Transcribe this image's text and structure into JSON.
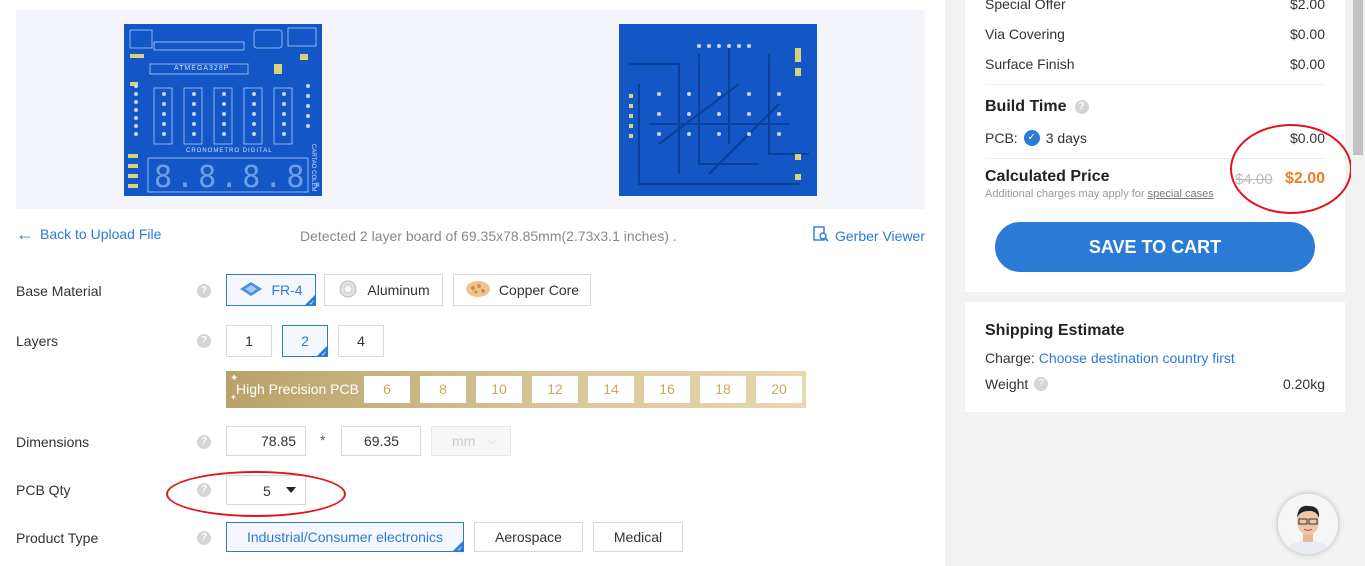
{
  "preview": {
    "top_chip_label": "ATMEGA328P",
    "board_caption": "CRONOMETRO DIGITAL",
    "digits_display": "8.8.8.8.",
    "side_caption": "CARTAO COLEM"
  },
  "nav": {
    "back_label": "Back to Upload File",
    "detected_text": "Detected 2 layer board of 69.35x78.85mm(2.73x3.1 inches) .",
    "gerber_label": "Gerber Viewer"
  },
  "form": {
    "help_glyph": "?",
    "base_material": {
      "label": "Base Material",
      "options": [
        "FR-4",
        "Aluminum",
        "Copper Core"
      ],
      "selected": "FR-4"
    },
    "layers": {
      "label": "Layers",
      "options": [
        "1",
        "2",
        "4"
      ],
      "selected": "2"
    },
    "high_precision": {
      "label": "High Precision PCB",
      "options": [
        "6",
        "8",
        "10",
        "12",
        "14",
        "16",
        "18",
        "20"
      ]
    },
    "dimensions": {
      "label": "Dimensions",
      "width": "78.85",
      "separator": "*",
      "height": "69.35",
      "unit": "mm"
    },
    "pcb_qty": {
      "label": "PCB Qty",
      "value": "5"
    },
    "product_type": {
      "label": "Product Type",
      "options": [
        "Industrial/Consumer electronics",
        "Aerospace",
        "Medical"
      ],
      "selected": "Industrial/Consumer electronics"
    }
  },
  "price": {
    "rows": [
      {
        "label": "Special Offer",
        "value": "$2.00"
      },
      {
        "label": "Via Covering",
        "value": "$0.00"
      },
      {
        "label": "Surface Finish",
        "value": "$0.00"
      }
    ],
    "build_time_title": "Build Time",
    "pcb_label": "PCB:",
    "pcb_days": "3 days",
    "pcb_value": "$0.00",
    "calc_title": "Calculated Price",
    "old_price": "$4.00",
    "new_price": "$2.00",
    "note_prefix": "Additional charges may apply for",
    "note_link": "special cases",
    "cart_button": "SAVE TO CART"
  },
  "shipping": {
    "title": "Shipping Estimate",
    "charge_label": "Charge:",
    "charge_link": "Choose destination country first",
    "weight_label": "Weight",
    "weight_value": "0.20kg"
  },
  "colors": {
    "accent": "#2b7bd6",
    "button": "#2b7bd6",
    "price_orange": "#f07c1e",
    "annotation_red": "#e0141b",
    "board_blue": "#1257c5"
  }
}
